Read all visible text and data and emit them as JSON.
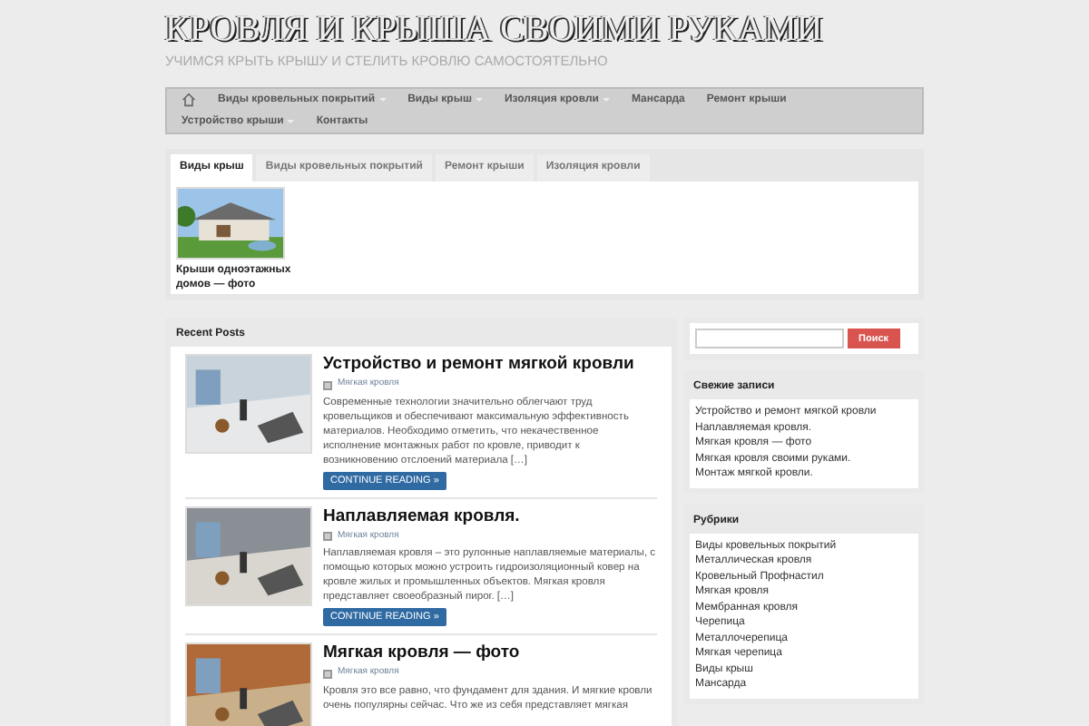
{
  "site": {
    "title": "КРОВЛЯ И КРЫША СВОИМИ РУКАМИ",
    "tagline": "УЧИМСЯ КРЫТЬ КРЫШУ И СТЕЛИТЬ КРОВЛЮ САМОСТОЯТЕЛЬНО"
  },
  "nav": [
    {
      "label": "Виды кровельных покрытий",
      "submenu": true
    },
    {
      "label": "Виды крыш",
      "submenu": true
    },
    {
      "label": "Изоляция кровли",
      "submenu": true
    },
    {
      "label": "Мансарда",
      "submenu": false
    },
    {
      "label": "Ремонт крыши",
      "submenu": false
    },
    {
      "label": "Устройство крыши",
      "submenu": true
    },
    {
      "label": "Контакты",
      "submenu": false
    }
  ],
  "tabs": [
    {
      "label": "Виды крыш",
      "selected": true
    },
    {
      "label": "Виды кровельных покрытий",
      "selected": false
    },
    {
      "label": "Ремонт крыши",
      "selected": false
    },
    {
      "label": "Изоляция кровли",
      "selected": false
    }
  ],
  "tab_items": [
    {
      "caption": "Крыши одноэтажных домов — фото"
    }
  ],
  "recent_posts": {
    "heading": "Recent Posts",
    "posts": [
      {
        "title": "Устройство и ремонт мягкой кровли",
        "category": "Мягкая кровля",
        "excerpt": "Современные технологии значительно облегчают труд кровельщиков и обеспечивают максимальную эффективность материалов. Необходимо отметить, что некачественное исполнение монтажных работ по кровле, приводит к возникновению отслоений материала […]",
        "button": "CONTINUE READING »"
      },
      {
        "title": "Наплавляемая кровля.",
        "category": "Мягкая кровля",
        "excerpt": "Наплавляемая кровля – это рулонные наплавляемые материалы, с помощью которых можно устроить гидроизоляционный ковер на кровле жилых и промышленных объектов. Мягкая кровля представляет своеобразный пирог. […]",
        "button": "CONTINUE READING »"
      },
      {
        "title": "Мягкая кровля — фото",
        "category": "Мягкая кровля",
        "excerpt": "Кровля это все равно, что фундамент для здания. И мягкие кровли очень популярны сейчас. Что же из себя представляет мягкая"
      }
    ]
  },
  "search": {
    "button": "Поиск"
  },
  "widgets": [
    {
      "heading": "Свежие записи",
      "items": [
        "Устройство и ремонт мягкой кровли",
        "Наплавляемая кровля.",
        "Мягкая кровля — фото",
        "Мягкая кровля своими руками.",
        "Монтаж мягкой кровли."
      ]
    },
    {
      "heading": "Рубрики",
      "items": [
        "Виды кровельных покрытий",
        "Металлическая кровля",
        "Кровельный Профнастил",
        "Мягкая кровля",
        "Мембранная кровля",
        "Черепица",
        "Металлочерепица",
        "Мягкая черепица",
        "Виды крыш",
        "Мансарда"
      ]
    }
  ]
}
